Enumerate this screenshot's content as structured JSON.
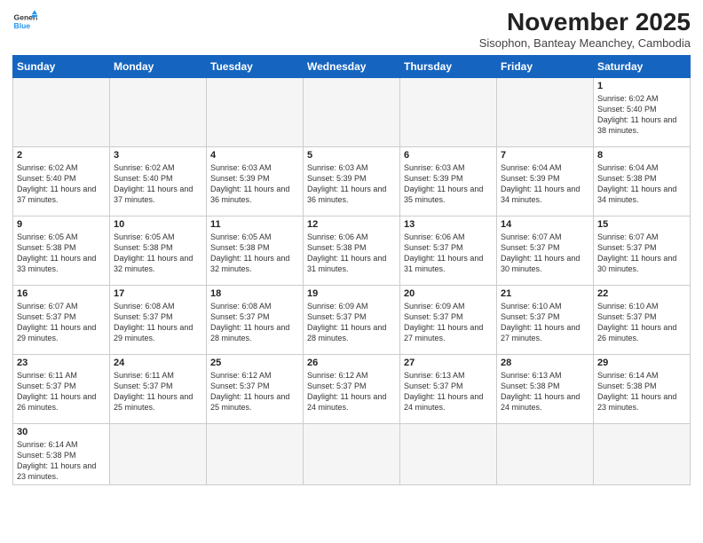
{
  "logo": {
    "line1": "General",
    "line2": "Blue"
  },
  "title": "November 2025",
  "subtitle": "Sisophon, Banteay Meanchey, Cambodia",
  "weekdays": [
    "Sunday",
    "Monday",
    "Tuesday",
    "Wednesday",
    "Thursday",
    "Friday",
    "Saturday"
  ],
  "weeks": [
    [
      {
        "day": "",
        "info": ""
      },
      {
        "day": "",
        "info": ""
      },
      {
        "day": "",
        "info": ""
      },
      {
        "day": "",
        "info": ""
      },
      {
        "day": "",
        "info": ""
      },
      {
        "day": "",
        "info": ""
      },
      {
        "day": "1",
        "info": "Sunrise: 6:02 AM\nSunset: 5:40 PM\nDaylight: 11 hours\nand 38 minutes."
      }
    ],
    [
      {
        "day": "2",
        "info": "Sunrise: 6:02 AM\nSunset: 5:40 PM\nDaylight: 11 hours\nand 37 minutes."
      },
      {
        "day": "3",
        "info": "Sunrise: 6:02 AM\nSunset: 5:40 PM\nDaylight: 11 hours\nand 37 minutes."
      },
      {
        "day": "4",
        "info": "Sunrise: 6:03 AM\nSunset: 5:39 PM\nDaylight: 11 hours\nand 36 minutes."
      },
      {
        "day": "5",
        "info": "Sunrise: 6:03 AM\nSunset: 5:39 PM\nDaylight: 11 hours\nand 36 minutes."
      },
      {
        "day": "6",
        "info": "Sunrise: 6:03 AM\nSunset: 5:39 PM\nDaylight: 11 hours\nand 35 minutes."
      },
      {
        "day": "7",
        "info": "Sunrise: 6:04 AM\nSunset: 5:39 PM\nDaylight: 11 hours\nand 34 minutes."
      },
      {
        "day": "8",
        "info": "Sunrise: 6:04 AM\nSunset: 5:38 PM\nDaylight: 11 hours\nand 34 minutes."
      }
    ],
    [
      {
        "day": "9",
        "info": "Sunrise: 6:05 AM\nSunset: 5:38 PM\nDaylight: 11 hours\nand 33 minutes."
      },
      {
        "day": "10",
        "info": "Sunrise: 6:05 AM\nSunset: 5:38 PM\nDaylight: 11 hours\nand 32 minutes."
      },
      {
        "day": "11",
        "info": "Sunrise: 6:05 AM\nSunset: 5:38 PM\nDaylight: 11 hours\nand 32 minutes."
      },
      {
        "day": "12",
        "info": "Sunrise: 6:06 AM\nSunset: 5:38 PM\nDaylight: 11 hours\nand 31 minutes."
      },
      {
        "day": "13",
        "info": "Sunrise: 6:06 AM\nSunset: 5:37 PM\nDaylight: 11 hours\nand 31 minutes."
      },
      {
        "day": "14",
        "info": "Sunrise: 6:07 AM\nSunset: 5:37 PM\nDaylight: 11 hours\nand 30 minutes."
      },
      {
        "day": "15",
        "info": "Sunrise: 6:07 AM\nSunset: 5:37 PM\nDaylight: 11 hours\nand 30 minutes."
      }
    ],
    [
      {
        "day": "16",
        "info": "Sunrise: 6:07 AM\nSunset: 5:37 PM\nDaylight: 11 hours\nand 29 minutes."
      },
      {
        "day": "17",
        "info": "Sunrise: 6:08 AM\nSunset: 5:37 PM\nDaylight: 11 hours\nand 29 minutes."
      },
      {
        "day": "18",
        "info": "Sunrise: 6:08 AM\nSunset: 5:37 PM\nDaylight: 11 hours\nand 28 minutes."
      },
      {
        "day": "19",
        "info": "Sunrise: 6:09 AM\nSunset: 5:37 PM\nDaylight: 11 hours\nand 28 minutes."
      },
      {
        "day": "20",
        "info": "Sunrise: 6:09 AM\nSunset: 5:37 PM\nDaylight: 11 hours\nand 27 minutes."
      },
      {
        "day": "21",
        "info": "Sunrise: 6:10 AM\nSunset: 5:37 PM\nDaylight: 11 hours\nand 27 minutes."
      },
      {
        "day": "22",
        "info": "Sunrise: 6:10 AM\nSunset: 5:37 PM\nDaylight: 11 hours\nand 26 minutes."
      }
    ],
    [
      {
        "day": "23",
        "info": "Sunrise: 6:11 AM\nSunset: 5:37 PM\nDaylight: 11 hours\nand 26 minutes."
      },
      {
        "day": "24",
        "info": "Sunrise: 6:11 AM\nSunset: 5:37 PM\nDaylight: 11 hours\nand 25 minutes."
      },
      {
        "day": "25",
        "info": "Sunrise: 6:12 AM\nSunset: 5:37 PM\nDaylight: 11 hours\nand 25 minutes."
      },
      {
        "day": "26",
        "info": "Sunrise: 6:12 AM\nSunset: 5:37 PM\nDaylight: 11 hours\nand 24 minutes."
      },
      {
        "day": "27",
        "info": "Sunrise: 6:13 AM\nSunset: 5:37 PM\nDaylight: 11 hours\nand 24 minutes."
      },
      {
        "day": "28",
        "info": "Sunrise: 6:13 AM\nSunset: 5:38 PM\nDaylight: 11 hours\nand 24 minutes."
      },
      {
        "day": "29",
        "info": "Sunrise: 6:14 AM\nSunset: 5:38 PM\nDaylight: 11 hours\nand 23 minutes."
      }
    ],
    [
      {
        "day": "30",
        "info": "Sunrise: 6:14 AM\nSunset: 5:38 PM\nDaylight: 11 hours\nand 23 minutes."
      },
      {
        "day": "",
        "info": ""
      },
      {
        "day": "",
        "info": ""
      },
      {
        "day": "",
        "info": ""
      },
      {
        "day": "",
        "info": ""
      },
      {
        "day": "",
        "info": ""
      },
      {
        "day": "",
        "info": ""
      }
    ]
  ]
}
